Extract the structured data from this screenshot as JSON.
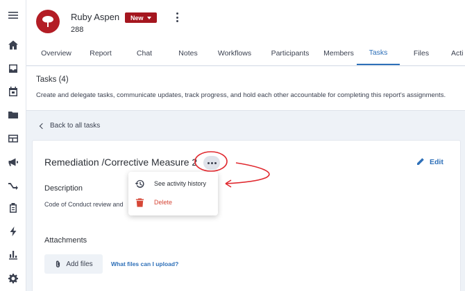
{
  "app": {
    "name": "Ruby Aspen",
    "sub": "288",
    "badge": "New"
  },
  "tabs": [
    "Overview",
    "Report",
    "Chat",
    "Notes",
    "Workflows",
    "Participants",
    "Members",
    "Tasks",
    "Files",
    "Acti"
  ],
  "active_tab": "Tasks",
  "info": {
    "title": "Tasks (4)",
    "description": "Create and delegate tasks, communicate updates, track progress, and hold each other accountable for completing this report's assignments."
  },
  "back_label": "Back to all tasks",
  "task": {
    "title": "Remediation /Corrective Measure 2",
    "edit_label": "Edit",
    "description_label": "Description",
    "description_text": "Code of Conduct review and",
    "attachments_label": "Attachments",
    "add_files_label": "Add files",
    "files_help_link": "What files can I upload?"
  },
  "menu": {
    "history_label": "See activity history",
    "delete_label": "Delete"
  },
  "colors": {
    "accent": "#2d6fb8",
    "brand": "#b31d25",
    "danger": "#d64636",
    "annotation": "#e0282e"
  },
  "rail_icons": [
    "menu-icon",
    "home-icon",
    "inbox-icon",
    "calendar-icon",
    "folder-icon",
    "table-icon",
    "megaphone-icon",
    "shuffle-icon",
    "clipboard-icon",
    "lightning-icon",
    "bar-chart-icon",
    "gear-icon"
  ]
}
